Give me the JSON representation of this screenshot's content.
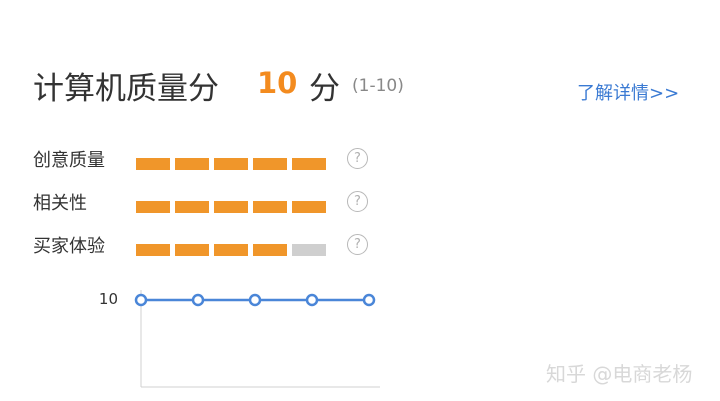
{
  "header": {
    "title": "计算机质量分",
    "score": "10",
    "score_unit": "分",
    "range": "(1-10)",
    "detail_link": "了解详情>>"
  },
  "metrics": [
    {
      "label": "创意质量",
      "filled": 5,
      "total": 5,
      "help": "?"
    },
    {
      "label": "相关性",
      "filled": 5,
      "total": 5,
      "help": "?"
    },
    {
      "label": "买家体验",
      "filled": 4,
      "total": 5,
      "help": "?"
    }
  ],
  "colors": {
    "accent": "#f38b1f",
    "bar_filled": "#f0962a",
    "bar_empty": "#cfcfcf",
    "link": "#3a7ad3",
    "line": "#4a86d8"
  },
  "chart_data": {
    "type": "line",
    "x": [
      1,
      2,
      3,
      4,
      5
    ],
    "series": [
      {
        "values": [
          10,
          10,
          10,
          10,
          10
        ]
      }
    ],
    "ytick_labels": [
      "10"
    ],
    "title": "",
    "xlabel": "",
    "ylabel": ""
  },
  "watermark": "知乎 @电商老杨"
}
